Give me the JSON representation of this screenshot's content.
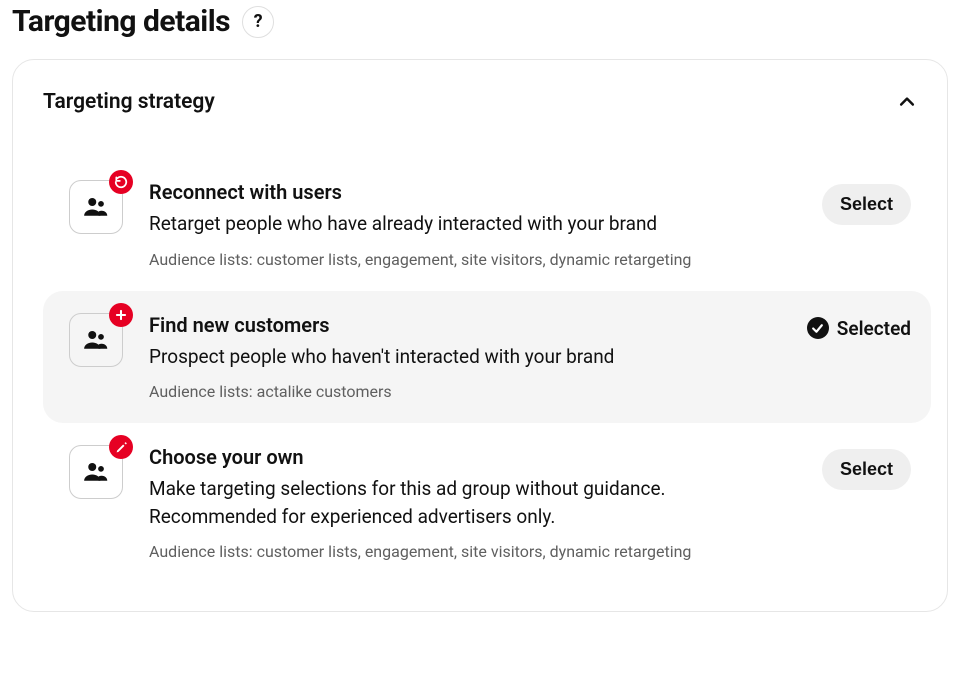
{
  "page": {
    "title": "Targeting details",
    "help_symbol": "?"
  },
  "section": {
    "title": "Targeting strategy"
  },
  "options": [
    {
      "title": "Reconnect with users",
      "desc": "Retarget people who have already interacted with your brand",
      "meta": "Audience lists: customer lists, engagement, site visitors, dynamic retargeting",
      "action_label": "Select",
      "selected": false
    },
    {
      "title": "Find new customers",
      "desc": "Prospect people who haven't interacted with your brand",
      "meta": "Audience lists: actalike customers",
      "action_label": "Selected",
      "selected": true
    },
    {
      "title": "Choose your own",
      "desc": "Make targeting selections for this ad group without guidance. Recommended for experienced advertisers only.",
      "meta": "Audience lists: customer lists, engagement, site visitors, dynamic retargeting",
      "action_label": "Select",
      "selected": false
    }
  ]
}
